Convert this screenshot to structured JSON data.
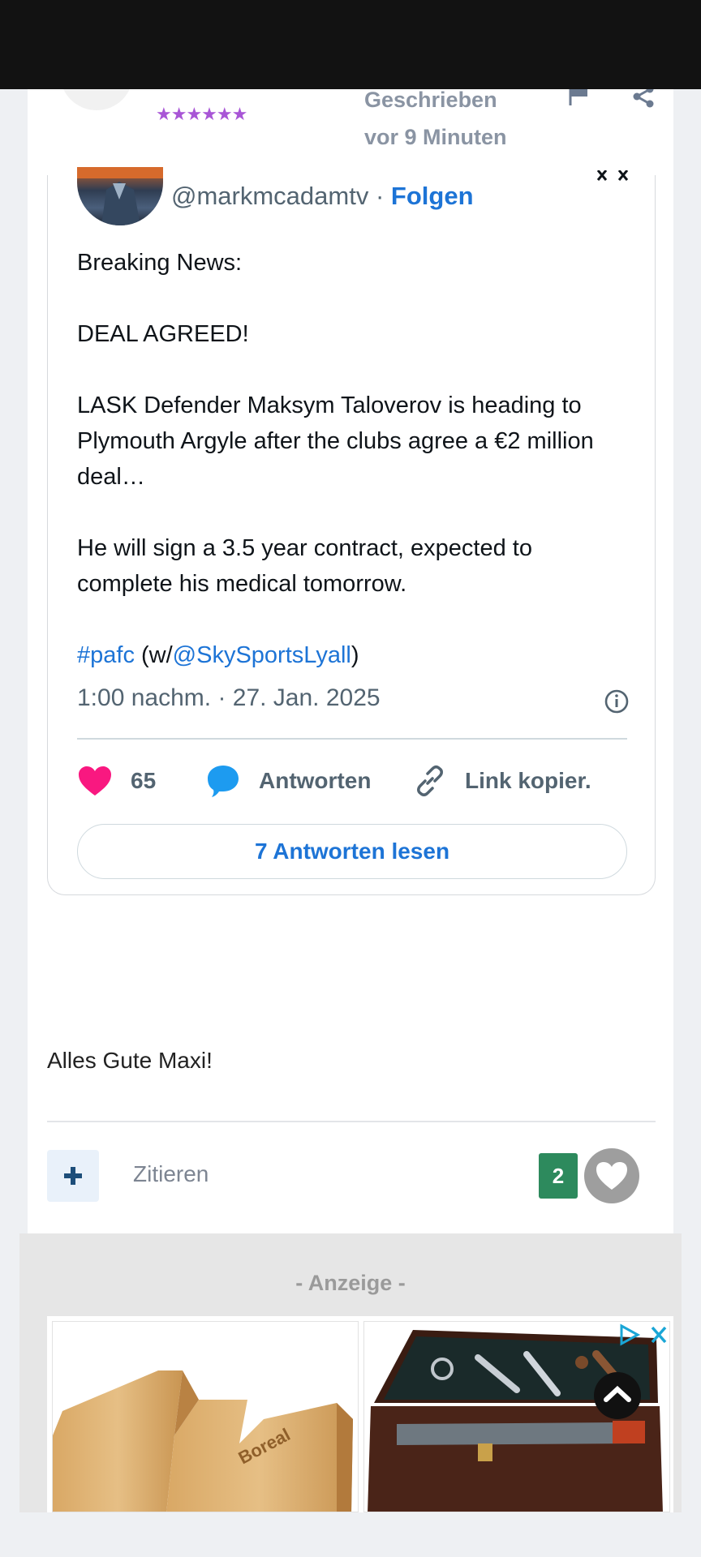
{
  "post": {
    "meta_line1": "Geschrieben",
    "meta_line2": "vor 9 Minuten",
    "rank_stars": "★★★★★★",
    "body_text": "Alles Gute Maxi!",
    "quote_label": "Zitieren",
    "like_count": "2"
  },
  "tweet": {
    "handle": "@markmcadamtv",
    "separator": " · ",
    "follow_label": "Folgen",
    "line1": "Breaking News:",
    "line2": "DEAL AGREED!",
    "line3": "LASK Defender Maksym Taloverov is heading to Plymouth Argyle after the clubs agree a €2 million deal…",
    "line4": "He will sign a 3.5 year contract, expected to complete his medical tomorrow.",
    "hashtag": "#pafc",
    "mention_prefix": " (w/",
    "mention": "@SkySportsLyall",
    "mention_suffix": ")",
    "timestamp": "1:00 nachm. · 27. Jan. 2025",
    "likes": "65",
    "reply_label": "Antworten",
    "copy_link_label": "Link kopier.",
    "read_replies_label": "7 Antworten lesen"
  },
  "ad": {
    "label": "- Anzeige -",
    "product1_text": "Boreal"
  },
  "colors": {
    "accent_blue": "#1d74d6",
    "like_green": "#2d8a5d",
    "heart_pink": "#f91880",
    "reply_blue": "#1d9bf0"
  }
}
